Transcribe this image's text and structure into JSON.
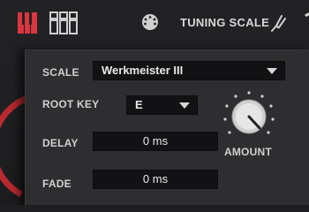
{
  "toolbar": {
    "tuning_button_icon": "piano-keys-icon",
    "mixer_button_icon": "mixer-faders-icon",
    "midi_button_icon": "midi-port-icon",
    "title": "TUNING SCALE",
    "tuning_fork_icon": "tuning-fork-icon",
    "accent_color": "#d9363e"
  },
  "panel": {
    "scale": {
      "label": "SCALE",
      "value": "Werkmeister III"
    },
    "root_key": {
      "label": "ROOT KEY",
      "value": "E"
    },
    "delay": {
      "label": "DELAY",
      "value": "0 ms"
    },
    "fade": {
      "label": "FADE",
      "value": "0 ms"
    },
    "amount": {
      "label": "AMOUNT",
      "knob_icon": "rotary-knob-icon"
    }
  }
}
